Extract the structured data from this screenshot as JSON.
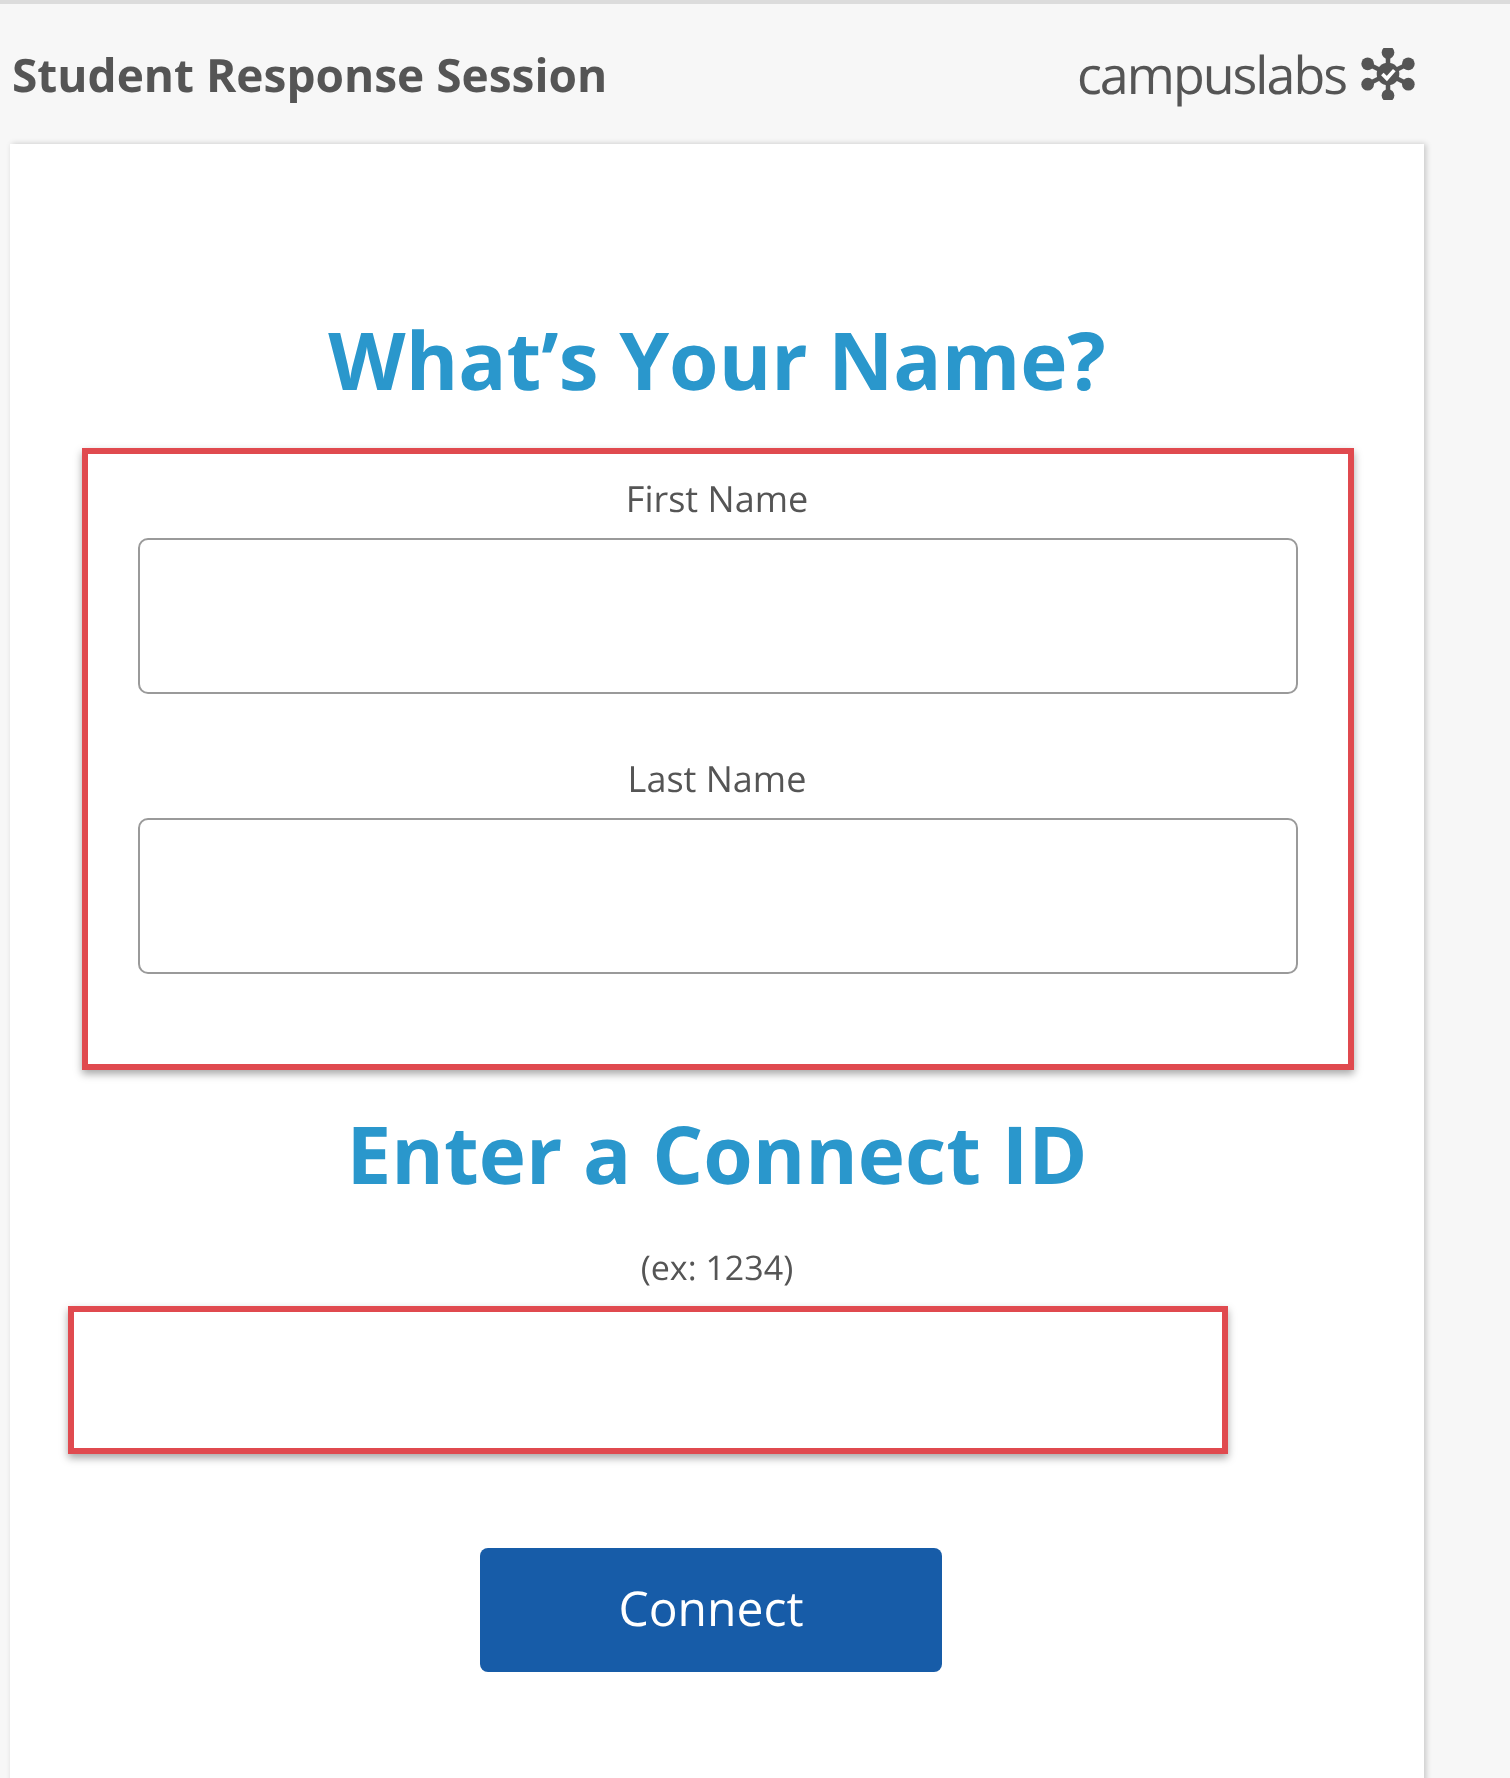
{
  "header": {
    "title": "Student Response Session",
    "logo_text": "campuslabs"
  },
  "name_section": {
    "heading": "What’s Your Name?",
    "highlighted": true,
    "fields": [
      {
        "label": "First Name"
      },
      {
        "label": "Last Name"
      }
    ]
  },
  "connect_section": {
    "heading": "Enter a Connect ID",
    "hint": "(ex: 1234)",
    "highlighted": true
  },
  "button": {
    "label": "Connect"
  }
}
